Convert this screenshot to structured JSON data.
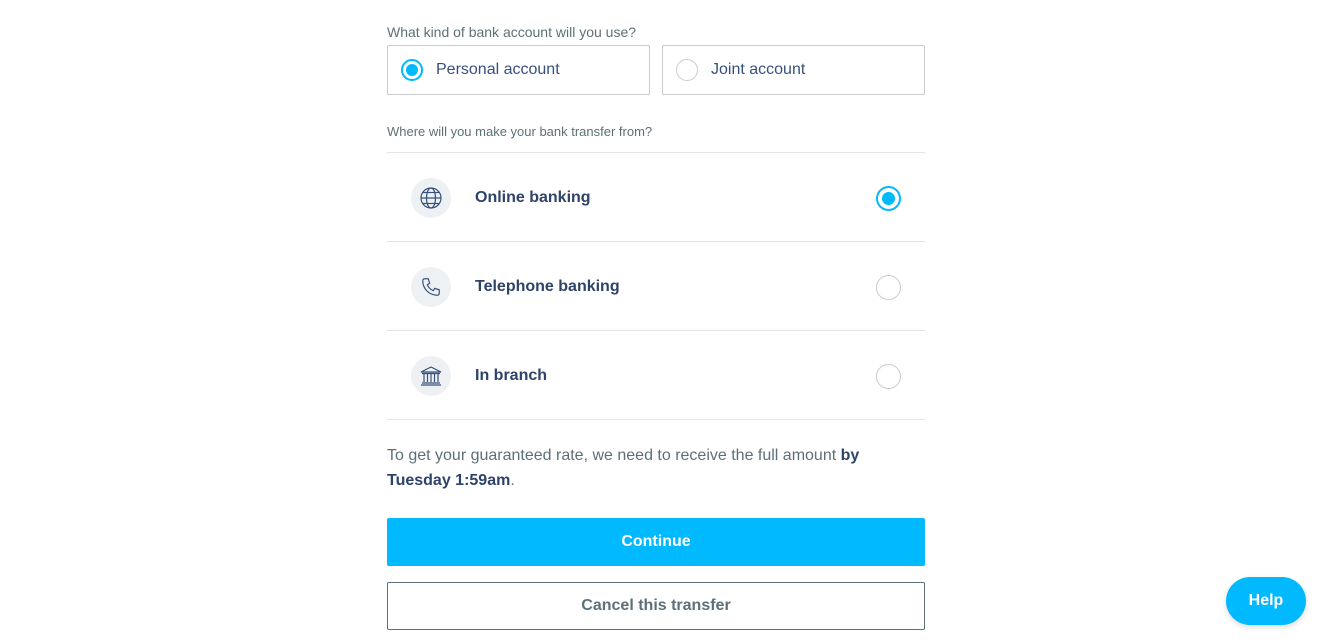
{
  "account_type": {
    "question": "What kind of bank account will you use?",
    "options": [
      {
        "label": "Personal account",
        "selected": true
      },
      {
        "label": "Joint account",
        "selected": false
      }
    ]
  },
  "transfer_method": {
    "question": "Where will you make your bank transfer from?",
    "options": [
      {
        "label": "Online banking",
        "icon": "globe-icon",
        "selected": true
      },
      {
        "label": "Telephone banking",
        "icon": "phone-icon",
        "selected": false
      },
      {
        "label": "In branch",
        "icon": "bank-icon",
        "selected": false
      }
    ]
  },
  "note": {
    "text": "To get your guaranteed rate, we need to receive the full amount ",
    "deadline": "by Tuesday 1:59am",
    "suffix": "."
  },
  "buttons": {
    "continue_label": "Continue",
    "cancel_label": "Cancel this transfer",
    "help_label": "Help"
  },
  "colors": {
    "accent": "#00b9ff",
    "text_dark": "#2e4369",
    "text_muted": "#5d7079"
  }
}
